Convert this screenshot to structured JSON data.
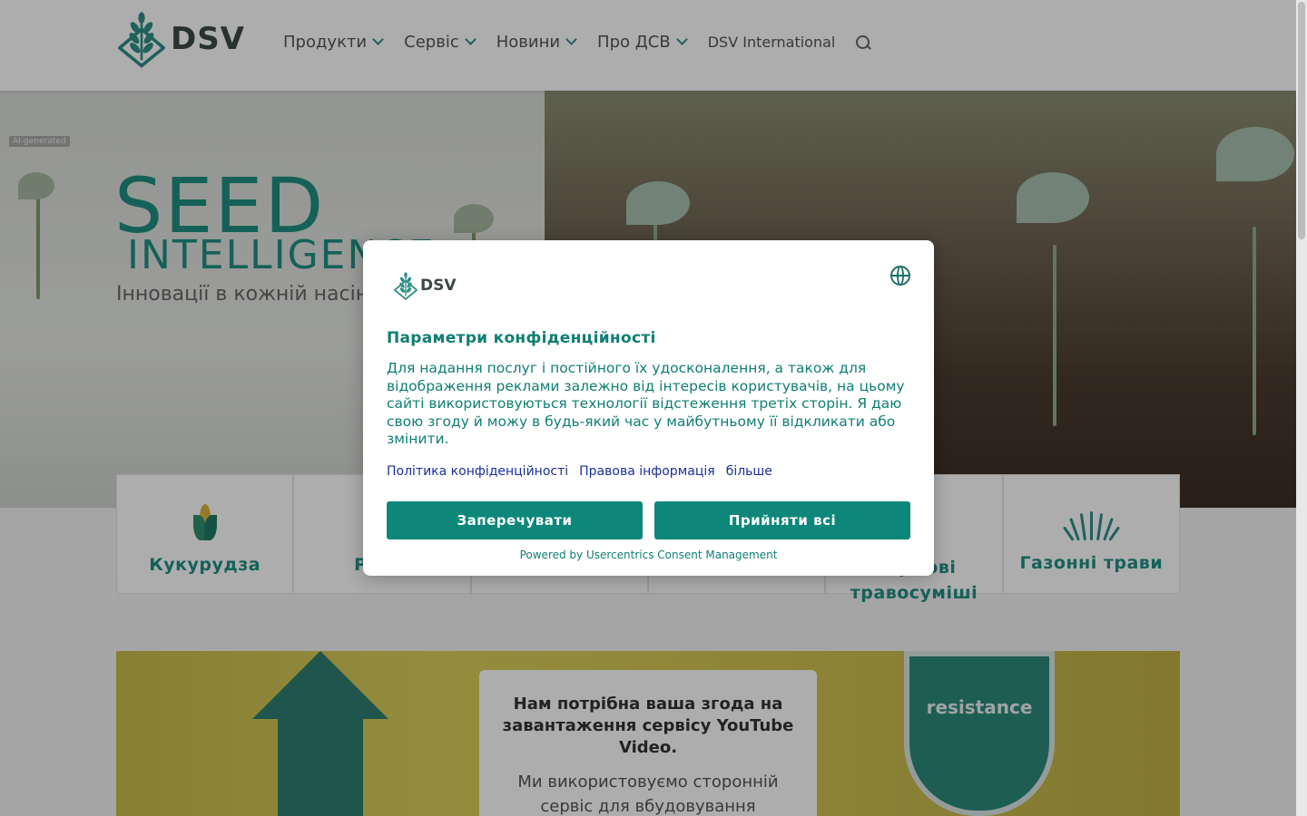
{
  "header": {
    "logo_text": "DSV",
    "nav": [
      {
        "label": "Продукти"
      },
      {
        "label": "Сервіс"
      },
      {
        "label": "Новини"
      },
      {
        "label": "Про ДСВ"
      }
    ],
    "international_link": "DSV International"
  },
  "hero": {
    "ai_tag": "AI-generated",
    "title": "SEED",
    "subtitle": "INTELLIGENCE",
    "tagline": "Інновації в кожній насінині"
  },
  "categories": [
    {
      "label": "Кукурудза",
      "icon": "corn-icon"
    },
    {
      "label": "Ріпак",
      "icon": ""
    },
    {
      "label": "",
      "icon": ""
    },
    {
      "label": "",
      "icon": ""
    },
    {
      "label": "Кормові травосуміші",
      "icon": ""
    },
    {
      "label": "Газонні трави",
      "icon": "grass-icon"
    }
  ],
  "video": {
    "shield_label": "resistance",
    "consent_title": "Нам потрібна ваша згода на завантаження сервісу YouTube Video.",
    "consent_text": "Ми використовуємо сторонній сервіс для вбудовування"
  },
  "modal": {
    "logo_text": "DSV",
    "title": "Параметри конфіденційності",
    "body": "Для надання послуг і постійного їх удосконалення, а також для відображення реклами залежно від інтересів користувачів, на цьому сайті використовуються технології відстеження третіх сторін. Я даю свою згоду й можу в будь-який час у майбутньому її відкликати або змінити.",
    "links": [
      "Політика конфіденційності",
      "Правова інформація",
      "більше"
    ],
    "deny_label": "Заперечувати",
    "accept_label": "Прийняти всі",
    "powered_by": "Powered by Usercentrics Consent Management"
  },
  "colors": {
    "brand_teal": "#0d877a",
    "link_blue": "#1a2f9c"
  }
}
